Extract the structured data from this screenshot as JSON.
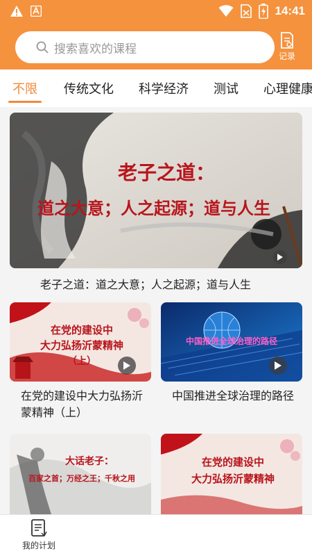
{
  "status_bar": {
    "time": "14:41"
  },
  "search": {
    "placeholder": "搜索喜欢的课程"
  },
  "record": {
    "label": "记录"
  },
  "tabs": [
    {
      "label": "不限",
      "active": true
    },
    {
      "label": "传统文化"
    },
    {
      "label": "科学经济"
    },
    {
      "label": "测试"
    },
    {
      "label": "心理健康"
    }
  ],
  "featured": {
    "banner_line1": "老子之道：",
    "banner_line2": "道之大意；人之起源；道与人生",
    "title": "老子之道：道之大意；人之起源；道与人生"
  },
  "courses": [
    {
      "banner_line1": "在党的建设中",
      "banner_line2": "大力弘扬沂蒙精神",
      "banner_line3": "（上）",
      "title_line1": "在党的建设中大力弘扬沂",
      "title_line2": "蒙精神（上）"
    },
    {
      "banner_line1": "中国推进全球治理的路径",
      "title_line1": "中国推进全球治理的路径",
      "title_line2": ""
    },
    {
      "banner_line1": "大话老子：",
      "banner_line2": "百家之首；万经之王；千秋之用"
    },
    {
      "banner_line1": "在党的建设中",
      "banner_line2": "大力弘扬沂蒙精神"
    }
  ],
  "bottom_nav": {
    "plan_label": "我的计划"
  },
  "colors": {
    "brand": "#f5923e",
    "tab_active": "#f08a3a",
    "banner_red": "#b8151c"
  }
}
